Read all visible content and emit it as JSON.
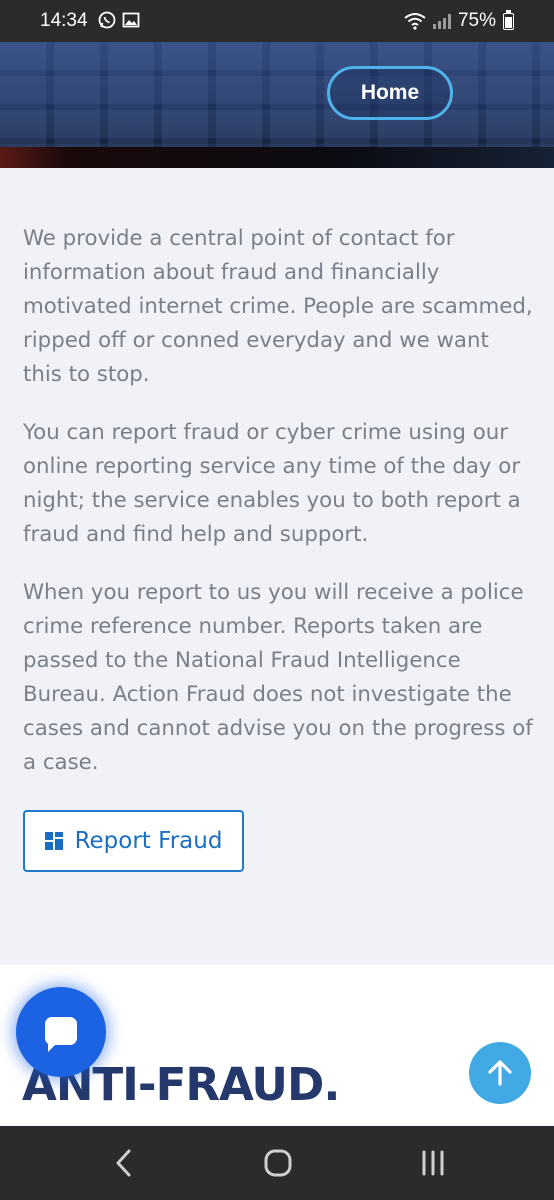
{
  "status": {
    "time": "14:34",
    "battery": "75%"
  },
  "hero": {
    "home_label": "Home"
  },
  "content": {
    "paragraphs": [
      "We provide a central point of contact for information about fraud and financially motivated internet crime. People are scammed, ripped off or conned everyday and we want this to stop.",
      "You can report fraud or cyber crime using our online reporting service any time of the day or night; the service enables you to both report a fraud and find help and support.",
      "When you report to us you will receive a police crime reference number. Reports taken are passed to the National Fraud Intelligence Bureau. Action Fraud does not investigate the cases and cannot advise you on the progress of a case."
    ],
    "report_button": "Report Fraud"
  },
  "section": {
    "title": "ANTI-FRAUD."
  },
  "icons": {
    "chat": "chat-icon",
    "scroll_top": "arrow-up-icon",
    "nav_back": "back-icon",
    "nav_home": "home-icon",
    "nav_recents": "recents-icon"
  },
  "colors": {
    "accent": "#1a6fc2",
    "title": "#24386b",
    "chat": "#1b63e2",
    "scroll_top": "#41a9e3"
  }
}
